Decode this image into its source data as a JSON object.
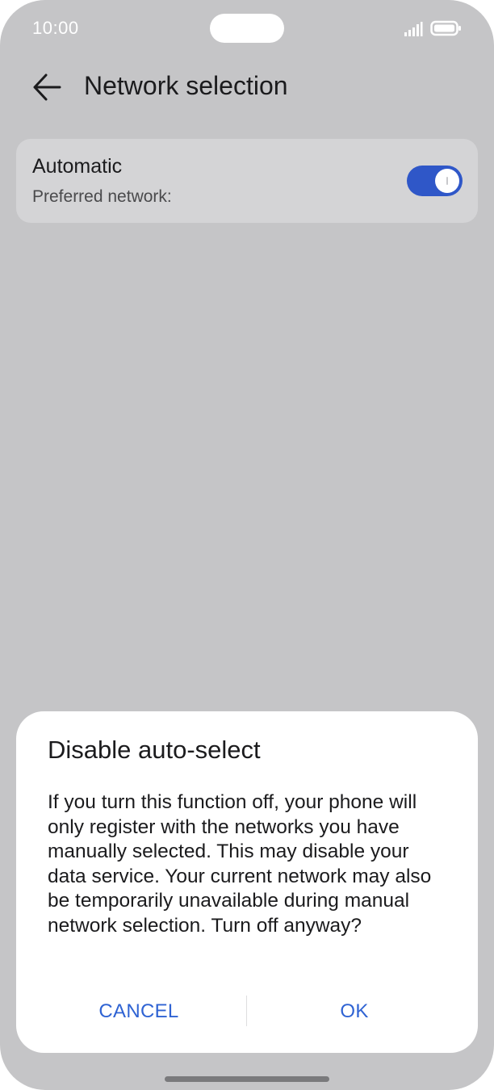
{
  "status_bar": {
    "time": "10:00"
  },
  "header": {
    "title": "Network selection",
    "back_icon": "arrow-left-icon"
  },
  "automatic_card": {
    "title": "Automatic",
    "subtitle": "Preferred network:",
    "toggle_on": true,
    "accent_color": "#2f57c8"
  },
  "dialog": {
    "title": "Disable auto-select",
    "message": "If you turn this function off, your phone will only register with the networks you have manually selected. This may disable your data service. Your current network may also be temporarily unavailable during manual network selection. Turn off anyway?",
    "cancel_label": "CANCEL",
    "ok_label": "OK",
    "button_color": "#2f63d3"
  }
}
